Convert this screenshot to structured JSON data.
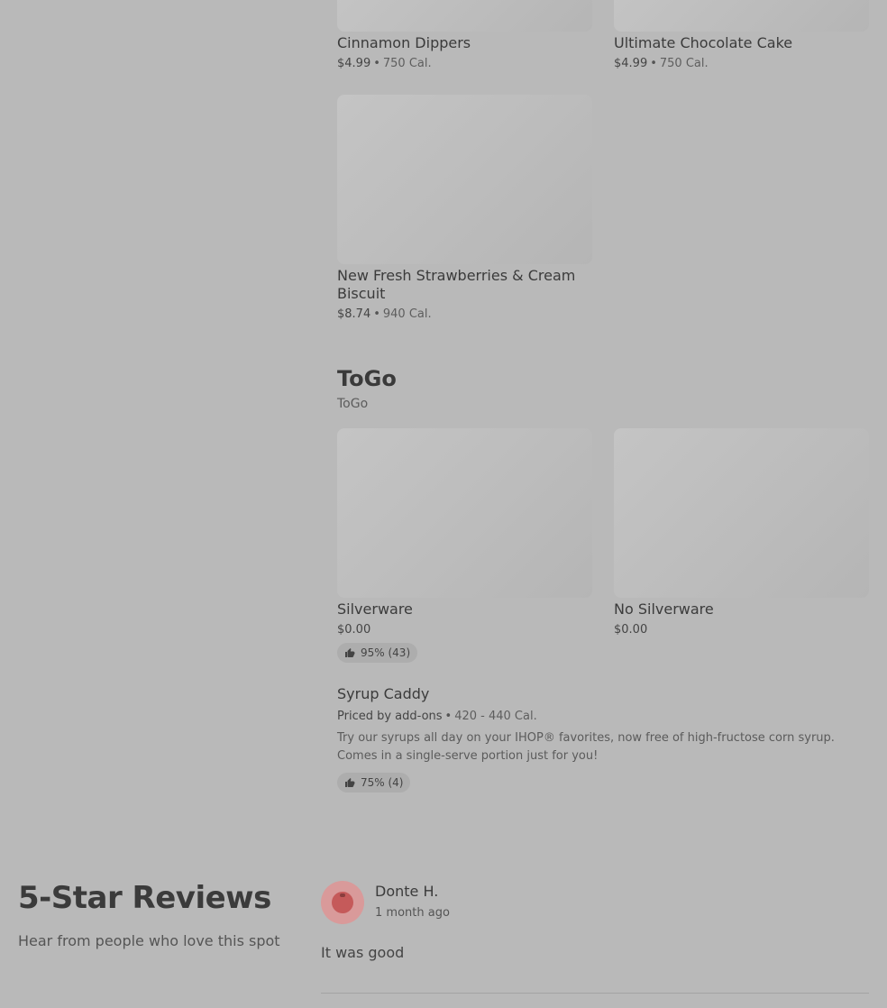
{
  "top_items": [
    {
      "name": "Cinnamon Dippers",
      "price": "$4.99",
      "cal": "750 Cal."
    },
    {
      "name": "Ultimate Chocolate Cake",
      "price": "$4.99",
      "cal": "750 Cal."
    },
    {
      "name": "New Fresh Strawberries & Cream Biscuit",
      "price": "$8.74",
      "cal": "940 Cal."
    }
  ],
  "togo": {
    "title": "ToGo",
    "subtitle": "ToGo",
    "items": [
      {
        "name": "Silverware",
        "price": "$0.00",
        "rating": "95% (43)"
      },
      {
        "name": "No Silverware",
        "price": "$0.00"
      },
      {
        "name": "Syrup Caddy",
        "price": "Priced by add-ons",
        "cal": "420 - 440 Cal.",
        "description": "Try our syrups all day on your IHOP® favorites, now free of high-fructose corn syrup. Comes in a single-serve portion just for you!",
        "rating": "75% (4)"
      }
    ]
  },
  "reviews": {
    "title": "5-Star Reviews",
    "subtitle": "Hear from people who love this spot",
    "items": [
      {
        "author": "Donte H.",
        "time": "1 month ago",
        "text": "It was good"
      }
    ]
  },
  "colors": {
    "background": "#b9b9b9",
    "avatar": "#d99a9a",
    "avatar_inner": "#c55a5a"
  },
  "icons": {
    "rating": "thumbs-up-icon"
  }
}
